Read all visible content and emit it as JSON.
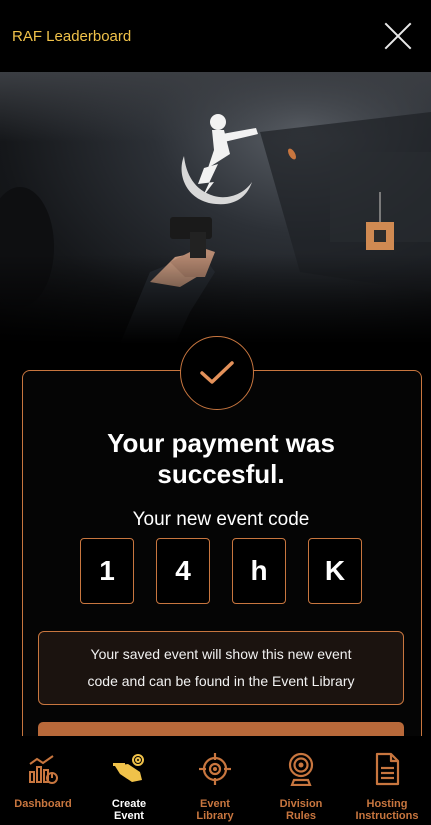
{
  "header": {
    "title": "RAF Leaderboard"
  },
  "success": {
    "headline_line1": "Your payment was",
    "headline_line2": "succesful.",
    "code_label": "Your new event code",
    "code_chars": [
      "1",
      "4",
      "h",
      "K"
    ],
    "note_line1": "Your saved event will show this new event",
    "note_line2": "code and can be found in the Event Library"
  },
  "tabs": [
    {
      "line1": "Dashboard",
      "line2": "",
      "icon": "dashboard-chart-icon",
      "active": false
    },
    {
      "line1": "Create",
      "line2": "Event",
      "icon": "shooter-target-icon",
      "active": true
    },
    {
      "line1": "Event",
      "line2": "Library",
      "icon": "crosshair-icon",
      "active": false
    },
    {
      "line1": "Division",
      "line2": "Rules",
      "icon": "target-stand-icon",
      "active": false
    },
    {
      "line1": "Hosting",
      "line2": "Instructions",
      "icon": "document-icon",
      "active": false
    }
  ],
  "colors": {
    "accent": "#c8763f",
    "title": "#f0c24a",
    "background": "#000000"
  }
}
